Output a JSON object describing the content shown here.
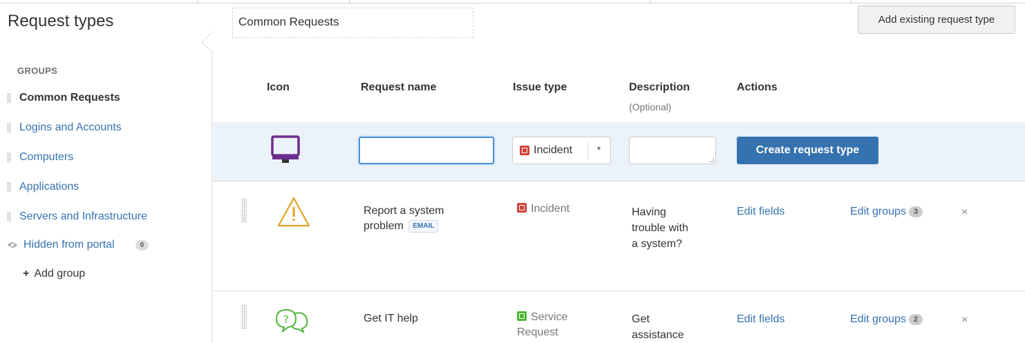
{
  "page_title": "Request types",
  "group_name": "Common Requests",
  "add_existing_label": "Add existing request type",
  "sidebar": {
    "heading": "GROUPS",
    "groups": [
      {
        "label": "Common Requests"
      },
      {
        "label": "Logins and Accounts"
      },
      {
        "label": "Computers"
      },
      {
        "label": "Applications"
      },
      {
        "label": "Servers and Infrastructure"
      }
    ],
    "hidden": {
      "label": "Hidden from portal",
      "count": "0"
    },
    "add_group_label": "Add group"
  },
  "columns": {
    "icon": "Icon",
    "name": "Request name",
    "issue_type": "Issue type",
    "description": "Description",
    "description_sub": "(Optional)",
    "actions": "Actions"
  },
  "new_row": {
    "icon": "monitor-icon",
    "name_value": "",
    "issue_type": "Incident",
    "description_value": "",
    "create_label": "Create request type"
  },
  "rows": [
    {
      "icon": "warning-icon",
      "name": "Report a system problem",
      "tag": "EMAIL",
      "issue_type": "Incident",
      "description": "Having trouble with a system?",
      "edit_fields": "Edit fields",
      "edit_groups": "Edit groups",
      "group_count": "3",
      "remove": "×"
    },
    {
      "icon": "help-chat-icon",
      "name": "Get IT help",
      "issue_type": "Service Request",
      "description": "Get assistance",
      "edit_fields": "Edit fields",
      "edit_groups": "Edit groups",
      "group_count": "2",
      "remove": "×"
    }
  ],
  "colors": {
    "link": "#3572b0",
    "primary_button": "#3572b0",
    "new_row_bg": "#ebf2f9",
    "incident": "#d04437",
    "service_request": "#4eb538",
    "monitor_icon": "#6b2d8e",
    "warning_icon": "#e3a325",
    "help_icon": "#4eb538"
  }
}
